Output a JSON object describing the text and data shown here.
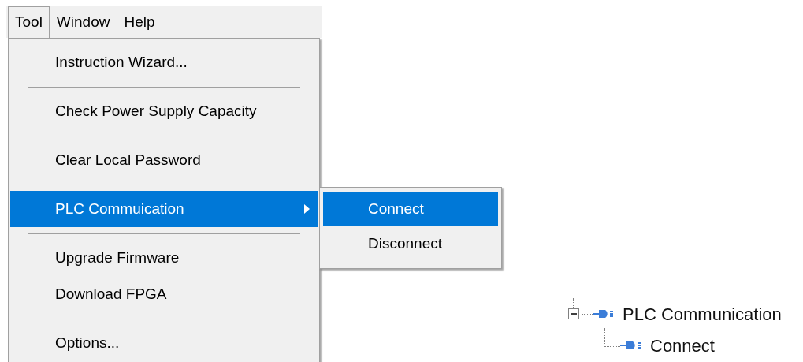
{
  "menu_bar": [
    {
      "label": "Tool",
      "selected": true
    },
    {
      "label": "Window",
      "selected": false
    },
    {
      "label": "Help",
      "selected": false
    }
  ],
  "tool_menu": [
    {
      "kind": "item",
      "label": "Instruction Wizard...",
      "selected": false
    },
    {
      "kind": "separator"
    },
    {
      "kind": "item",
      "label": "Check Power Supply Capacity",
      "selected": false
    },
    {
      "kind": "separator"
    },
    {
      "kind": "item",
      "label": "Clear Local Password",
      "selected": false
    },
    {
      "kind": "separator"
    },
    {
      "kind": "submenu",
      "label": "PLC Commuication",
      "selected": true
    },
    {
      "kind": "separator"
    },
    {
      "kind": "item",
      "label": "Upgrade Firmware",
      "selected": false
    },
    {
      "kind": "item",
      "label": "Download FPGA",
      "selected": false
    },
    {
      "kind": "separator"
    },
    {
      "kind": "item",
      "label": "Options...",
      "selected": false
    }
  ],
  "submenu": [
    {
      "label": "Connect",
      "selected": true
    },
    {
      "label": "Disconnect",
      "selected": false
    }
  ],
  "tree": {
    "label": "PLC Communication",
    "expanded": true,
    "children": [
      {
        "label": "Connect"
      }
    ]
  }
}
